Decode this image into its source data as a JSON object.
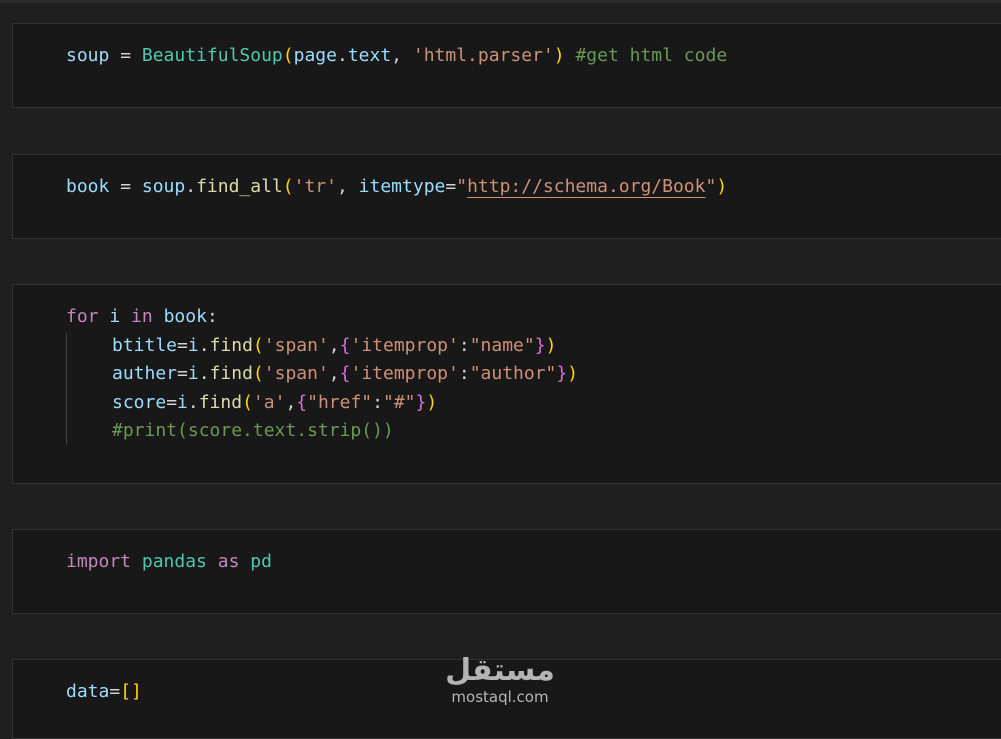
{
  "cells": [
    {
      "lines": [
        {
          "tokens": [
            "soup",
            " = ",
            "BeautifulSoup",
            "(",
            "page",
            ".",
            "text",
            ", ",
            "'html.parser'",
            ")",
            " ",
            "#get html code"
          ]
        }
      ]
    },
    {
      "lines": [
        {
          "tokens": [
            "book",
            " = ",
            "soup",
            ".",
            "find_all",
            "(",
            "'tr'",
            ", ",
            "itemtype",
            "=",
            "\"",
            "http://schema.org/Book",
            "\"",
            ")"
          ]
        }
      ]
    },
    {
      "lines": [
        {
          "tokens": [
            "for",
            " ",
            "i",
            " ",
            "in",
            " ",
            "book",
            ":"
          ]
        },
        {
          "tokens": [
            "btitle",
            "=",
            "i",
            ".",
            "find",
            "(",
            "'span'",
            ",",
            "{",
            "'itemprop'",
            ":",
            "\"name\"",
            "}",
            ")"
          ]
        },
        {
          "tokens": [
            "auther",
            "=",
            "i",
            ".",
            "find",
            "(",
            "'span'",
            ",",
            "{",
            "'itemprop'",
            ":",
            "\"author\"",
            "}",
            ")"
          ]
        },
        {
          "tokens": [
            "score",
            "=",
            "i",
            ".",
            "find",
            "(",
            "'a'",
            ",",
            "{",
            "\"href\"",
            ":",
            "\"#\"",
            "}",
            ")"
          ]
        },
        {
          "tokens": [
            "#print(score.text.strip())"
          ]
        }
      ]
    },
    {
      "lines": [
        {
          "tokens": [
            "import",
            " ",
            "pandas",
            " ",
            "as",
            " ",
            "pd"
          ]
        }
      ]
    },
    {
      "lines": [
        {
          "tokens": [
            "data",
            "=",
            "[",
            "]"
          ]
        }
      ]
    }
  ],
  "watermark": {
    "arabic": "مستقل",
    "latin": "mostaql.com"
  },
  "colors": {
    "background": "#1f1f1f",
    "cell_background": "#181818",
    "variable": "#9cdcfe",
    "class": "#4ec9b0",
    "function": "#dcdcaa",
    "string": "#ce9178",
    "comment": "#6a9955",
    "keyword": "#c586c0",
    "bracket_level1": "#ffd700",
    "bracket_level2": "#da70d6"
  }
}
